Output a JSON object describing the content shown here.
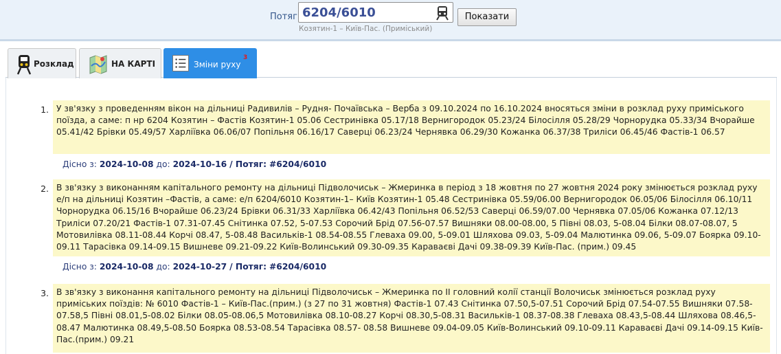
{
  "search": {
    "label": "Потяг",
    "value": "6204/6010",
    "route": "Козятин-1 – Київ-Пас. (Приміський)",
    "button": "Показати"
  },
  "tabs": [
    {
      "label": "Розклад",
      "icon": "train-icon"
    },
    {
      "label": "НА КАРТІ",
      "icon": "map-icon"
    },
    {
      "label": "Зміни руху",
      "icon": "list-icon",
      "badge": "3",
      "active": true
    }
  ],
  "notices": [
    {
      "number": "1.",
      "text": "У зв'язку з проведенням вікон на дільниці Радивилів – Рудня- Почаївська – Верба з 09.10.2024 по 16.10.2024 вносяться зміни в розклад руху приміського поїзда, а саме: п нр 6204 Козятин – Фастів Козятин-1 05.06 Сестринівка 05.17/18 Вернигородок 05.23/24 Білосілля 05.28/29 Чорнорудка 05.33/34 Вчорайше 05.41/42 Брівки 05.49/57 Харліївка 06.06/07 Попільня 06.16/17 Саверці 06.23/24 Чернявка 06.29/30 Кожанка 06.37/38 Триліси 06.45/46 Фастів-1 06.57",
      "valid_label": "Дісно з:",
      "from": "2024-10-08",
      "to_label": "до:",
      "to": "2024-10-16",
      "train_label": "/ Потяг:",
      "train": "#6204/6010"
    },
    {
      "number": "2.",
      "text": "В зв'язку з виконанням капітального ремонту на дільниці Підволочиськ – Жмеринка в період з 18 жовтня по 27 жовтня 2024 року змінюється розклад руху е/п на дільниці Козятин –Фастів, а саме: е/п 6204/6010 Козятин-1– Київ Козятин-1 05.48 Сестринівка 05.59/06.00 Вернигородок 06.05/06 Білосілля 06.10/11 Чорнорудка 06.15/16 Вчорайше 06.23/24 Брівки 06.31/33 Харліївка 06.42/43 Попільня 06.52/53 Саверці 06.59/07.00 Чернявка 07.05/06 Кожанка 07.12/13 Триліси 07.20/21 Фастів-1 07.31-07.45 Снітинка 07.52, 5-07.53 Сорочий Брід 07.56-07.57 Вишняки 08.00-08.00, 5 Півні 08.03, 5-08.04 Білки 08.07-08.07, 5 Мотовилівка 08.11-08.44 Корчі 08.47, 5-08.48 Васильків-1 08.54-08.55 Глеваха 09.00, 5-09.01 Шляхова 09.03, 5-09.04 Малютинка 09.06, 5-09.07 Боярка 09.10-09.11 Тарасівка 09.14-09.15 Вишневе 09.21-09.22 Київ-Волинський 09.30-09.35 Караваєві Дачі 09.38-09.39 Київ-Пас. (прим.) 09.45",
      "valid_label": "Дісно з:",
      "from": "2024-10-08",
      "to_label": "до:",
      "to": "2024-10-27",
      "train_label": "/ Потяг:",
      "train": "#6204/6010"
    },
    {
      "number": "3.",
      "text": "В зв'язку з виконання капітального ремонту на дільниці Підволочиськ – Жмеринка по ІІ головний колії станції Волочиськ змінюється розклад руху приміських поїздів: № 6010 Фастів-1 – Київ-Пас.(прим.) (з 27 по 31 жовтня) Фастів-1 07.43 Снітинка 07.50,5-07.51 Сорочий Брід 07.54-07.55 Вишняки 07.58-07.58,5 Півні 08.01,5-08.02 Білки 08.05-08.06,5 Мотовилівка 08.10-08.27 Корчі 08.30,5-08.31 Васильків-1 08.37-08.38 Глеваха 08.43,5-08.44 Шляхова 08.46,5-08.47 Малютинка 08.49,5-08.50 Боярка 08.53-08.54 Тарасівка 08.57- 08.58 Вишневе 09.04-09.05 Київ-Волинський 09.10-09.11 Караваєві Дачі 09.14-09.15 Київ-Пас.(прим.) 09.21"
    }
  ],
  "colors": {
    "topbar": "#eaf2fa",
    "active_tab": "#2e8ee6",
    "notice_bg": "#fcf8c9",
    "badge": "#e21a1a"
  }
}
